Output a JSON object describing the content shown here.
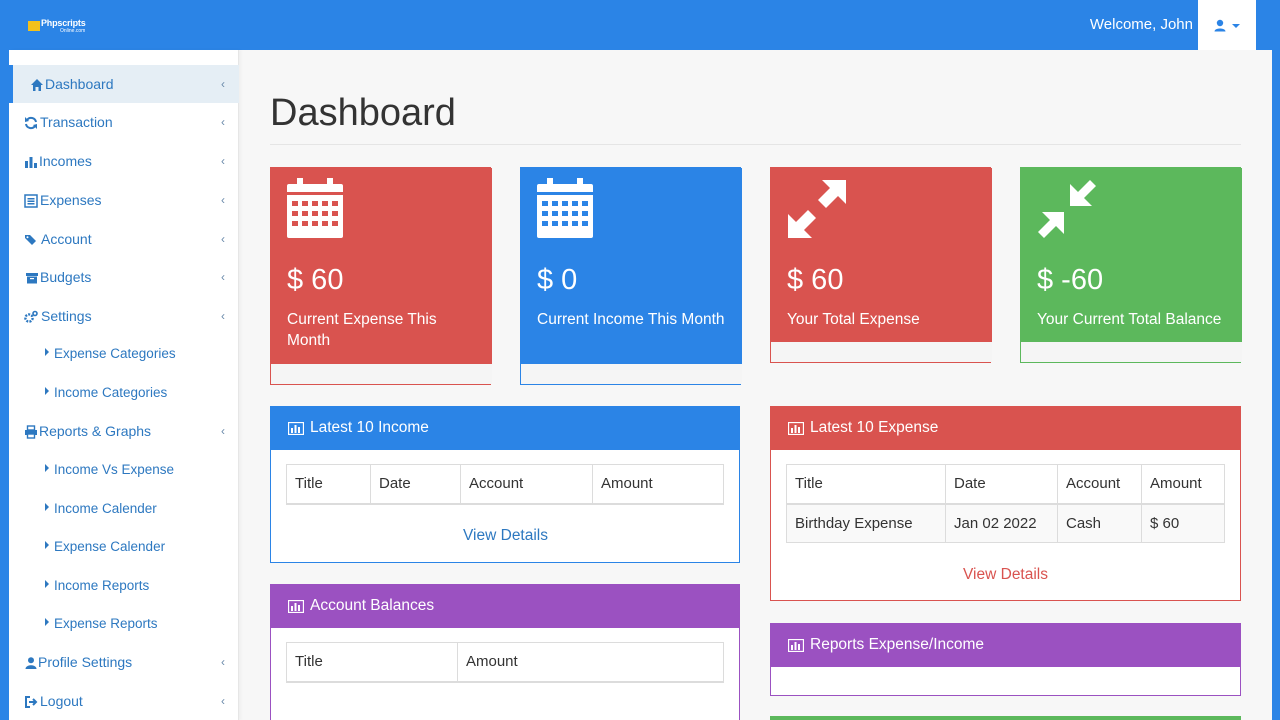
{
  "header": {
    "logo_text": "Phpscripts",
    "logo_subtext": "Online.com",
    "welcome": "Welcome, John",
    "user_icon": "user-icon",
    "accent": "#2b84e6"
  },
  "sidebar": {
    "items": [
      {
        "label": "Dashboard",
        "icon": "home-icon"
      },
      {
        "label": "Transaction",
        "icon": "refresh-icon"
      },
      {
        "label": "Incomes",
        "icon": "bar-chart-icon"
      },
      {
        "label": "Expenses",
        "icon": "list-icon"
      },
      {
        "label": "Account",
        "icon": "tags-icon"
      },
      {
        "label": "Budgets",
        "icon": "archive-icon"
      },
      {
        "label": "Settings",
        "icon": "cogs-icon"
      },
      {
        "label": "Expense Categories"
      },
      {
        "label": "Income Categories"
      },
      {
        "label": "Reports & Graphs",
        "icon": "print-icon"
      },
      {
        "label": "Income Vs Expense"
      },
      {
        "label": "Income Calender"
      },
      {
        "label": "Expense Calender"
      },
      {
        "label": "Income Reports"
      },
      {
        "label": "Expense Reports"
      },
      {
        "label": "Profile Settings",
        "icon": "user-icon"
      },
      {
        "label": "Logout",
        "icon": "sign-out-icon"
      }
    ]
  },
  "main": {
    "title": "Dashboard",
    "stats": [
      {
        "value": "$ 60",
        "label": "Current Expense This Month",
        "color": "#d9534f",
        "icon": "calendar-icon"
      },
      {
        "value": "$ 0",
        "label": "Current Income This Month",
        "color": "#2b84e6",
        "icon": "calendar-icon"
      },
      {
        "value": "$ 60",
        "label": "Your Total Expense",
        "color": "#d9534f",
        "icon": "expand-arrows-icon"
      },
      {
        "value": "$ -60",
        "label": "Your Current Total Balance",
        "color": "#5cb85c",
        "icon": "compress-arrows-icon"
      }
    ],
    "income_panel": {
      "title": "Latest 10 Income",
      "columns": [
        "Title",
        "Date",
        "Account",
        "Amount"
      ],
      "view_details": "View Details"
    },
    "expense_panel": {
      "title": "Latest 10 Expense",
      "columns": [
        "Title",
        "Date",
        "Account",
        "Amount"
      ],
      "rows": [
        [
          "Birthday Expense",
          "Jan 02 2022",
          "Cash",
          "$ 60"
        ]
      ],
      "view_details": "View Details"
    },
    "balances_panel": {
      "title": "Account Balances",
      "columns": [
        "Title",
        "Amount"
      ]
    },
    "reports_panel": {
      "title": "Reports Expense/Income"
    },
    "colors": {
      "red": "#d9534f",
      "blue": "#2b84e6",
      "green": "#5cb85c",
      "purple": "#9b51c1"
    }
  }
}
